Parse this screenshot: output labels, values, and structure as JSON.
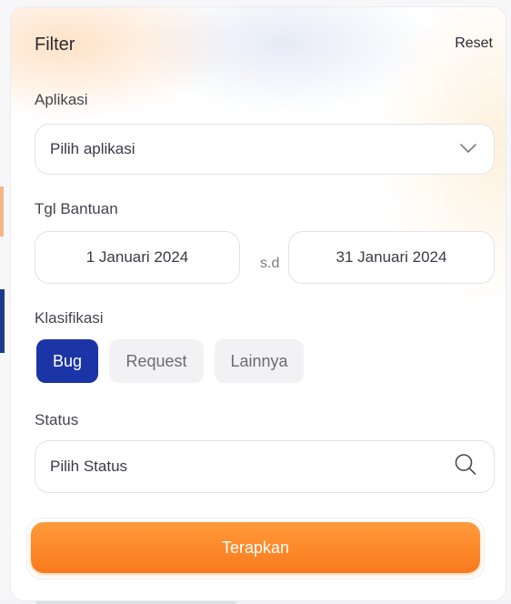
{
  "header": {
    "title": "Filter",
    "reset_label": "Reset"
  },
  "aplikasi": {
    "label": "Aplikasi",
    "value": "Pilih aplikasi"
  },
  "tgl_bantuan": {
    "label": "Tgl Bantuan",
    "start": "1 Januari 2024",
    "separator": "s.d",
    "end": "31 Januari 2024"
  },
  "klasifikasi": {
    "label": "Klasifikasi",
    "options": [
      "Bug",
      "Request",
      "Lainnya"
    ],
    "selected": "Bug"
  },
  "status": {
    "label": "Status",
    "placeholder": "Pilih Status"
  },
  "apply_label": "Terapkan",
  "colors": {
    "accent_orange": "#fa7a1c",
    "selected_chip": "#1c35a6",
    "chip_inactive": "#f2f2f4"
  },
  "icons": {
    "aplikasi_dropdown": "chevron-down-icon",
    "status_search": "search-icon"
  }
}
